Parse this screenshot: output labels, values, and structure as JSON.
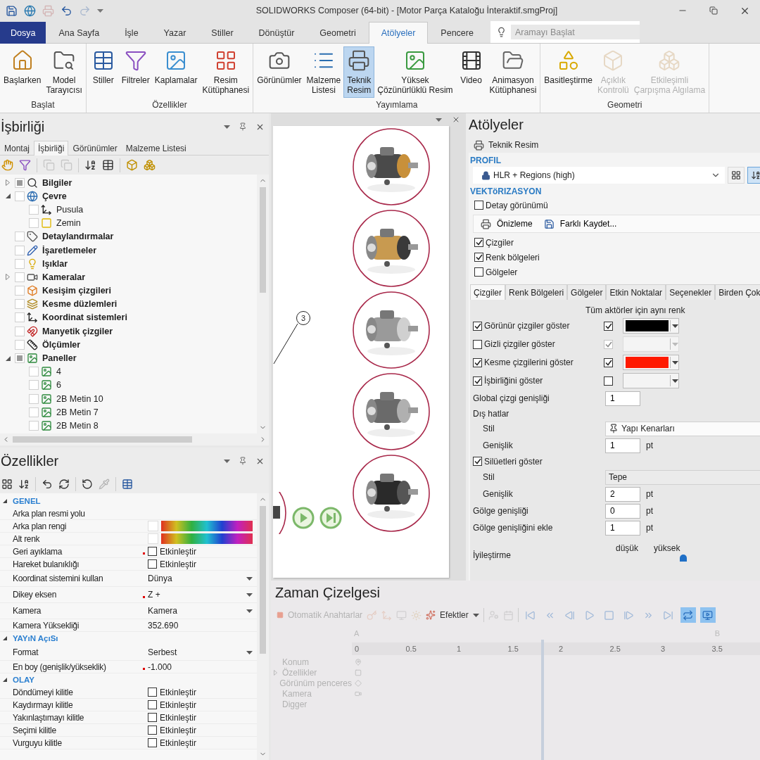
{
  "title_bar": {
    "title": "SOLIDWORKS Composer (64-bit) - [Motor Parça Kataloğu İnteraktif.smgProj]",
    "quick_access": [
      {
        "disabled": false
      },
      {
        "disabled": false
      },
      {
        "disabled": true
      },
      {
        "disabled": false
      },
      {
        "disabled": true
      }
    ]
  },
  "menu_tabs": [
    {
      "kind": "file",
      "label": "Dosya",
      "selected": false
    },
    {
      "kind": "tab",
      "label": "Ana Sayfa",
      "selected": false
    },
    {
      "kind": "tab",
      "label": "İşle",
      "selected": false
    },
    {
      "kind": "tab",
      "label": "Yazar",
      "selected": false
    },
    {
      "kind": "tab",
      "label": "Stiller",
      "selected": false
    },
    {
      "kind": "tab",
      "label": "Dönüştür",
      "selected": false
    },
    {
      "kind": "tab",
      "label": "Geometri",
      "selected": false
    },
    {
      "kind": "tab",
      "label": "Atölyeler",
      "selected": true
    },
    {
      "kind": "tab",
      "label": "Pencere",
      "selected": false
    }
  ],
  "search": {
    "placeholder": "Aramayı Başlat"
  },
  "ribbon": [
    {
      "label": "Başlat",
      "buttons": [
        {
          "label": "Başlarken",
          "selected": false,
          "disabled": false
        },
        {
          "label": "Model\nTarayıcısı",
          "selected": false,
          "disabled": false
        }
      ]
    },
    {
      "label": "Özellikler",
      "buttons": [
        {
          "label": "Stiller",
          "selected": false,
          "disabled": false
        },
        {
          "label": "Filtreler",
          "selected": false,
          "disabled": false
        },
        {
          "label": "Kaplamalar",
          "selected": false,
          "disabled": false
        },
        {
          "label": "Resim\nKütüphanesi",
          "selected": false,
          "disabled": false
        }
      ]
    },
    {
      "label": "Yayımlama",
      "buttons": [
        {
          "label": "Görünümler",
          "selected": false,
          "disabled": false
        },
        {
          "label": "Malzeme\nListesi",
          "selected": false,
          "disabled": false
        },
        {
          "label": "Teknik\nResim",
          "selected": true,
          "disabled": false
        },
        {
          "label": "Yüksek\nÇözünürlüklü Resim",
          "selected": false,
          "disabled": false
        },
        {
          "label": "Video",
          "selected": false,
          "disabled": false
        },
        {
          "label": "Animasyon\nKütüphanesi",
          "selected": false,
          "disabled": false
        }
      ]
    },
    {
      "label": "Geometri",
      "buttons": [
        {
          "label": "Basitleştirme",
          "selected": false,
          "disabled": false
        },
        {
          "label": "Açıklık\nKontrolü",
          "selected": false,
          "disabled": true
        },
        {
          "label": "Etkileşimli\nÇarpışma Algılama",
          "selected": false,
          "disabled": true
        }
      ]
    }
  ],
  "collaboration": {
    "title": "İşbirliği",
    "tabs": [
      {
        "label": "Montaj",
        "selected": false
      },
      {
        "label": "İşbirliği",
        "selected": true
      },
      {
        "label": "Görünümler",
        "selected": false
      },
      {
        "label": "Malzeme Listesi",
        "selected": false
      }
    ],
    "toolbar": [
      {
        "disabled": false
      },
      {
        "disabled": false
      },
      {
        "disabled": true
      },
      {
        "disabled": true
      },
      {
        "disabled": false
      },
      {
        "disabled": false
      },
      {
        "disabled": false
      },
      {
        "disabled": false
      }
    ],
    "tree": [
      {
        "label": "Bilgiler",
        "partial": true,
        "expanded": false
      },
      {
        "label": "Çevre",
        "partial": false,
        "expanded": true,
        "children": [
          {
            "label": "Pusula",
            "partial": false
          },
          {
            "label": "Zemin",
            "partial": false
          }
        ]
      },
      {
        "label": "Detaylandırmalar",
        "partial": false
      },
      {
        "label": "İşaretlemeler",
        "partial": false
      },
      {
        "label": "Işıklar",
        "partial": false
      },
      {
        "label": "Kameralar",
        "partial": false,
        "expanded": false
      },
      {
        "label": "Kesişim çizgileri",
        "partial": false
      },
      {
        "label": "Kesme düzlemleri",
        "partial": false
      },
      {
        "label": "Koordinat sistemleri",
        "partial": false
      },
      {
        "label": "Manyetik çizgiler",
        "partial": false
      },
      {
        "label": "Ölçümler",
        "partial": false
      },
      {
        "label": "Paneller",
        "partial": true,
        "expanded": true,
        "children": [
          {
            "label": "4",
            "partial": false
          },
          {
            "label": "6",
            "partial": false
          },
          {
            "label": "2B Metin 10",
            "partial": false
          },
          {
            "label": "2B Metin 7",
            "partial": false
          },
          {
            "label": "2B Metin 8",
            "partial": false
          }
        ]
      }
    ]
  },
  "properties": {
    "title": "Özellikler",
    "toolbar": [
      {
        "disabled": false
      },
      {
        "disabled": false
      },
      {
        "disabled": false
      },
      {
        "disabled": false
      },
      {
        "disabled": false
      },
      {
        "disabled": true
      },
      {
        "disabled": false
      }
    ],
    "sections": [
      {
        "label": "GENEL",
        "expanded": true,
        "rows": [
          {
            "kind": "text",
            "label": "Arka plan resmi yolu",
            "modified": false
          },
          {
            "kind": "color",
            "label": "Arka plan rengi",
            "modified": false
          },
          {
            "kind": "color",
            "label": "Alt renk",
            "modified": false
          },
          {
            "kind": "checkbox",
            "label": "Geri ayıklama",
            "value": "Etkinleştir",
            "checked": false,
            "modified": true
          },
          {
            "kind": "checkbox",
            "label": "Hareket bulanıklığı",
            "value": "Etkinleştir",
            "checked": false,
            "modified": false
          },
          {
            "kind": "dropdown",
            "label": "Koordinat sistemini kullan",
            "value": "Dünya",
            "modified": false
          },
          {
            "kind": "dropdown",
            "label": "Dikey eksen",
            "value": "Z +",
            "modified": true
          },
          {
            "kind": "dropdown",
            "label": "Kamera",
            "value": "Kamera",
            "modified": false
          },
          {
            "kind": "value",
            "label": "Kamera Yüksekliği",
            "value": "352.690",
            "modified": false
          }
        ]
      },
      {
        "label": "YAYıN AçıSı",
        "expanded": true,
        "rows": [
          {
            "kind": "dropdown",
            "label": "Format",
            "value": "Serbest",
            "modified": false
          },
          {
            "kind": "value",
            "label": "En boy (genişlik/yükseklik)",
            "value": "-1.000",
            "modified": true
          }
        ]
      },
      {
        "label": "OLAY",
        "expanded": true,
        "rows": [
          {
            "kind": "checkbox",
            "label": "Döndümeyi kilitle",
            "value": "Etkinleştir",
            "checked": false,
            "modified": false
          },
          {
            "kind": "checkbox",
            "label": "Kaydırmayı kilitle",
            "value": "Etkinleştir",
            "checked": false,
            "modified": false
          },
          {
            "kind": "checkbox",
            "label": "Yakınlaştımayı kilitle",
            "value": "Etkinleştir",
            "checked": false,
            "modified": false
          },
          {
            "kind": "checkbox",
            "label": "Seçimi kilitle",
            "value": "Etkinleştir",
            "checked": false,
            "modified": false
          },
          {
            "kind": "checkbox",
            "label": "Vurguyu kilitle",
            "value": "Etkinleştir",
            "checked": false,
            "modified": false
          }
        ]
      }
    ]
  },
  "viewport": {
    "callout": "3"
  },
  "workshop": {
    "title": "Atölyeler",
    "subtitle": "Teknik Resim",
    "profile": {
      "heading": "PROFIL",
      "value": "HLR + Regions (high)",
      "locked": true,
      "view_buttons": [
        {
          "selected": false
        },
        {
          "selected": true
        }
      ]
    },
    "vectorization": {
      "heading": "VEKTöRIZASYON",
      "detail": {
        "label": "Detay görünümü",
        "checked": false
      },
      "actions": [
        {
          "label": "Önizleme"
        },
        {
          "label": "Farklı Kaydet..."
        }
      ],
      "layers": [
        {
          "label": "Çizgiler",
          "checked": true
        },
        {
          "label": "Renk bölgeleri",
          "checked": true
        },
        {
          "label": "Gölgeler",
          "checked": false
        }
      ]
    },
    "tabs": [
      {
        "label": "Çizgiler",
        "selected": true
      },
      {
        "label": "Renk Bölgeleri",
        "selected": false
      },
      {
        "label": "Gölgeler",
        "selected": false
      },
      {
        "label": "Etkin Noktalar",
        "selected": false
      },
      {
        "label": "Seçenekler",
        "selected": false
      },
      {
        "label": "Birden Çok",
        "selected": false
      }
    ],
    "lines": {
      "heading": "Tüm aktörler için aynı renk",
      "rows": [
        {
          "label": "Görünür çizgiler göster",
          "checked": true,
          "same_color": true,
          "disabled": false,
          "color": "#000000"
        },
        {
          "label": "Gizli çizgiler göster",
          "checked": false,
          "same_color": true,
          "disabled": true
        },
        {
          "label": "Kesme çizgilerini göster",
          "checked": true,
          "same_color": true,
          "disabled": false,
          "color": "#ff1a00"
        },
        {
          "label": "İşbirliğini göster",
          "checked": true,
          "same_color": false,
          "disabled": false
        }
      ]
    },
    "fields": [
      {
        "kind": "input",
        "label": "Global çizgi genişliği",
        "value": "1"
      },
      {
        "kind": "group",
        "label": "Dış hatlar",
        "children": [
          {
            "kind": "select",
            "label": "Stil",
            "value": "Yapı Kenarları"
          },
          {
            "kind": "input",
            "label": "Genişlik",
            "value": "1",
            "unit": "pt"
          }
        ]
      },
      {
        "kind": "check_group",
        "label": "Silüetleri göster",
        "checked": true,
        "children": [
          {
            "kind": "plain_select",
            "label": "Stil",
            "value": "Tepe"
          },
          {
            "kind": "input",
            "label": "Genişlik",
            "value": "2",
            "unit": "pt"
          }
        ]
      },
      {
        "kind": "input",
        "label": "Gölge genişliği",
        "value": "0",
        "unit": "pt"
      },
      {
        "kind": "input",
        "label": "Gölge genişliğini ekle",
        "value": "1",
        "unit": "pt"
      },
      {
        "kind": "slider",
        "label": "İyileştirme",
        "min_label": "düşük",
        "max_label": "yüksek",
        "level": 0.85
      }
    ]
  },
  "timeline": {
    "title": "Zaman Çizelgesi",
    "auto_keys": "Otomatik Anahtarlar",
    "effects": "Efektler",
    "playback": [
      {
        "selected": false
      },
      {
        "selected": false
      },
      {
        "selected": false
      },
      {
        "selected": false
      },
      {
        "selected": false
      },
      {
        "selected": false
      },
      {
        "selected": false
      },
      {
        "selected": false
      },
      {
        "selected": true
      },
      {
        "selected": true
      }
    ],
    "markers": [
      "A",
      "B"
    ],
    "ruler": [
      "0",
      "0.5",
      "1",
      "1.5",
      "2",
      "2.5",
      "3",
      "3.5"
    ],
    "playhead": {
      "level": 0.46
    },
    "tracks": [
      {
        "label": "Konum",
        "expandable": false
      },
      {
        "label": "Özellikler",
        "expandable": true
      },
      {
        "label": "Görünüm penceres",
        "expandable": false
      },
      {
        "label": "Kamera",
        "expandable": false
      },
      {
        "label": "Digger",
        "expandable": false
      }
    ]
  }
}
